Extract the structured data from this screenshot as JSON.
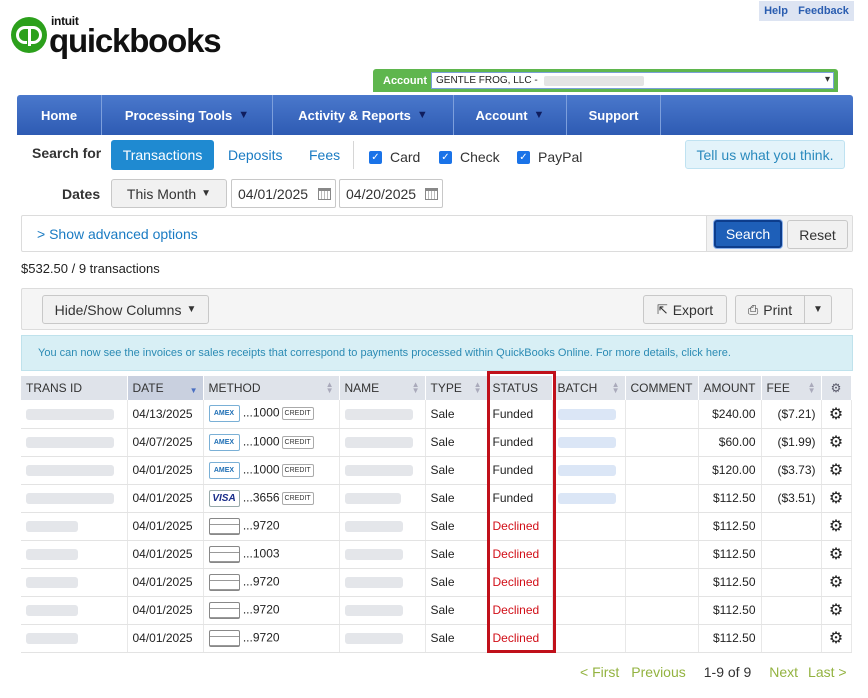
{
  "brand": {
    "intuit": "intuit",
    "wordmark": "quickbooks"
  },
  "toplinks": {
    "help": "Help",
    "feedback": "Feedback"
  },
  "account_bar": {
    "label": "Account",
    "selected": "GENTLE FROG, LLC -"
  },
  "nav": [
    "Home",
    "Processing Tools",
    "Activity & Reports",
    "Account",
    "Support"
  ],
  "search": {
    "label": "Search for",
    "tabs": [
      "Transactions",
      "Deposits",
      "Fees"
    ],
    "checkboxes": [
      "Card",
      "Check",
      "PayPal"
    ],
    "feedback_button": "Tell us what you think."
  },
  "dates": {
    "label": "Dates",
    "range_button": "This Month",
    "from": "04/01/2025",
    "to": "04/20/2025"
  },
  "advanced": {
    "link": "> Show advanced options",
    "search": "Search",
    "reset": "Reset"
  },
  "summary": "$532.50 / 9 transactions",
  "toolbar": {
    "columns": "Hide/Show Columns",
    "export": "Export",
    "print": "Print"
  },
  "notice": "You can now see the invoices or sales receipts that correspond to payments processed within QuickBooks Online. For more details, click here.",
  "colors": {
    "accent": "#1f8ad1",
    "nav": "#3563bd",
    "declined": "#d10e17",
    "highlight": "#c0101a",
    "brand": "#2ca01c"
  },
  "table": {
    "columns": [
      "TRANS ID",
      "DATE",
      "METHOD",
      "NAME",
      "TYPE",
      "STATUS",
      "BATCH",
      "COMMENT",
      "AMOUNT",
      "FEE"
    ],
    "rows": [
      {
        "date": "04/13/2025",
        "card": "AMEX",
        "last4": "...1000",
        "credit": "CREDIT",
        "type": "Sale",
        "status": "Funded",
        "amount": "$240.00",
        "fee": "($7.21)"
      },
      {
        "date": "04/07/2025",
        "card": "AMEX",
        "last4": "...1000",
        "credit": "CREDIT",
        "type": "Sale",
        "status": "Funded",
        "amount": "$60.00",
        "fee": "($1.99)"
      },
      {
        "date": "04/01/2025",
        "card": "AMEX",
        "last4": "...1000",
        "credit": "CREDIT",
        "type": "Sale",
        "status": "Funded",
        "amount": "$120.00",
        "fee": "($3.73)"
      },
      {
        "date": "04/01/2025",
        "card": "VISA",
        "last4": "...3656",
        "credit": "CREDIT",
        "type": "Sale",
        "status": "Funded",
        "amount": "$112.50",
        "fee": "($3.51)"
      },
      {
        "date": "04/01/2025",
        "card": "",
        "last4": "...9720",
        "credit": "",
        "type": "Sale",
        "status": "Declined",
        "amount": "$112.50",
        "fee": ""
      },
      {
        "date": "04/01/2025",
        "card": "",
        "last4": "...1003",
        "credit": "",
        "type": "Sale",
        "status": "Declined",
        "amount": "$112.50",
        "fee": ""
      },
      {
        "date": "04/01/2025",
        "card": "",
        "last4": "...9720",
        "credit": "",
        "type": "Sale",
        "status": "Declined",
        "amount": "$112.50",
        "fee": ""
      },
      {
        "date": "04/01/2025",
        "card": "",
        "last4": "...9720",
        "credit": "",
        "type": "Sale",
        "status": "Declined",
        "amount": "$112.50",
        "fee": ""
      },
      {
        "date": "04/01/2025",
        "card": "",
        "last4": "...9720",
        "credit": "",
        "type": "Sale",
        "status": "Declined",
        "amount": "$112.50",
        "fee": ""
      }
    ]
  },
  "pager": {
    "first": "< First",
    "previous": "Previous",
    "range": "1-9 of 9",
    "next": "Next",
    "last": "Last >"
  }
}
